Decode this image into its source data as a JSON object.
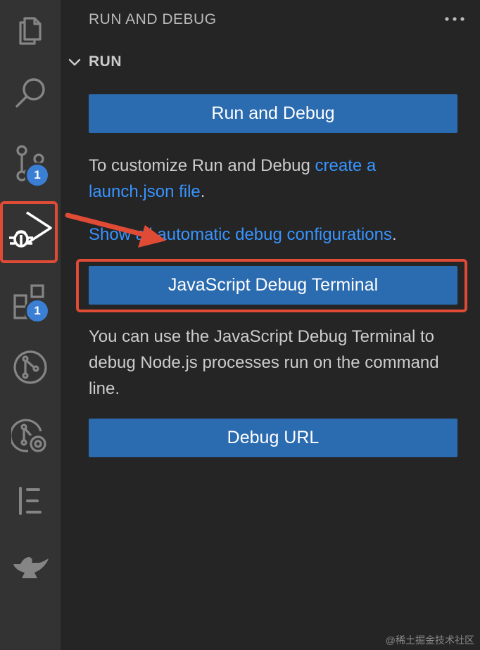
{
  "sidebar": {
    "title": "RUN AND DEBUG",
    "section_title": "RUN",
    "run_debug_label": "Run and Debug",
    "customize_text": "To customize Run and Debug ",
    "create_link": "create a launch.json file",
    "customize_end": ".",
    "show_all_link": "Show all automatic debug configurations",
    "show_all_end": ".",
    "js_debug_terminal_label": "JavaScript Debug Terminal",
    "description": "You can use the JavaScript Debug Terminal to debug Node.js processes run on the command line.",
    "debug_url_label": "Debug URL"
  },
  "activity_bar": {
    "items": [
      {
        "icon": "explorer-icon"
      },
      {
        "icon": "search-icon"
      },
      {
        "icon": "source-control-icon",
        "badge": "1"
      },
      {
        "icon": "run-debug-icon",
        "active": true
      },
      {
        "icon": "extensions-icon",
        "badge": "1"
      },
      {
        "icon": "git-graph-icon"
      },
      {
        "icon": "gitlens-icon"
      },
      {
        "icon": "timeline-icon"
      },
      {
        "icon": "genie-lamp-icon"
      }
    ]
  },
  "colors": {
    "accent": "#2b6bb0",
    "link": "#3794ff",
    "annotation": "#e04b36",
    "badge": "#3a7fd4"
  },
  "watermark": "@稀土掘金技术社区"
}
